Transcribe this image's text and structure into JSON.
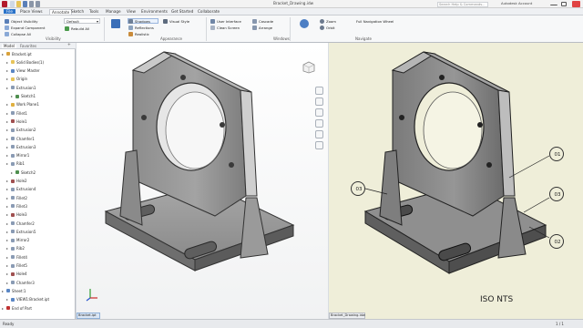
{
  "window": {
    "title": "Bracket_Drawing.idw",
    "search_placeholder": "Search Help & Commands...",
    "user": "Autodesk Account",
    "controls": [
      "minimize-icon",
      "maximize-icon",
      "close-icon"
    ]
  },
  "tabs": [
    {
      "label": "File"
    },
    {
      "label": "Place Views"
    },
    {
      "label": "Annotate",
      "active": true
    },
    {
      "label": "Sketch"
    },
    {
      "label": "Tools"
    },
    {
      "label": "Manage"
    },
    {
      "label": "View"
    },
    {
      "label": "Environments"
    },
    {
      "label": "Get Started"
    },
    {
      "label": "Collaborate"
    }
  ],
  "ribbon": {
    "groups": [
      {
        "label": "Visibility",
        "buttons": [
          "Object Visibility",
          "Expand Component",
          "Collapse All"
        ]
      },
      {
        "label": "Appearance",
        "buttons": [
          "Visual Style",
          "Shadows",
          "Reflections",
          "Realistic"
        ]
      },
      {
        "label": "Windows",
        "buttons": [
          "User Interface",
          "Clean Screen",
          "Cascade",
          "Arrange"
        ]
      },
      {
        "label": "Navigate",
        "buttons": [
          "Full Navigation Wheel",
          "Zoom",
          "Orbit"
        ]
      }
    ],
    "style_value": "Default",
    "rebuild_label": "Rebuild All"
  },
  "browser": {
    "tabs": [
      "Model",
      "Favorites"
    ],
    "tree": [
      {
        "label": "Bracket.ipt",
        "level": 0,
        "icon": "part"
      },
      {
        "label": "Solid Bodies(1)",
        "level": 1,
        "icon": "folder"
      },
      {
        "label": "View: Master",
        "level": 1,
        "icon": "view"
      },
      {
        "label": "Origin",
        "level": 1,
        "icon": "folder"
      },
      {
        "label": "Extrusion1",
        "level": 1,
        "icon": "feature"
      },
      {
        "label": "Sketch1",
        "level": 2,
        "icon": "sketch"
      },
      {
        "label": "Work Plane1",
        "level": 1,
        "icon": "plane"
      },
      {
        "label": "Fillet1",
        "level": 1,
        "icon": "feature"
      },
      {
        "label": "Hole1",
        "level": 1,
        "icon": "hole"
      },
      {
        "label": "Extrusion2",
        "level": 1,
        "icon": "feature"
      },
      {
        "label": "Chamfer1",
        "level": 1,
        "icon": "feature"
      },
      {
        "label": "Extrusion3",
        "level": 1,
        "icon": "feature"
      },
      {
        "label": "Mirror1",
        "level": 1,
        "icon": "feature"
      },
      {
        "label": "Rib1",
        "level": 1,
        "icon": "feature"
      },
      {
        "label": "Sketch2",
        "level": 2,
        "icon": "sketch"
      },
      {
        "label": "Hole2",
        "level": 1,
        "icon": "hole"
      },
      {
        "label": "Extrusion4",
        "level": 1,
        "icon": "feature"
      },
      {
        "label": "Fillet2",
        "level": 1,
        "icon": "feature"
      },
      {
        "label": "Fillet3",
        "level": 1,
        "icon": "feature"
      },
      {
        "label": "Hole3",
        "level": 1,
        "icon": "hole"
      },
      {
        "label": "Chamfer2",
        "level": 1,
        "icon": "feature"
      },
      {
        "label": "Extrusion5",
        "level": 1,
        "icon": "feature"
      },
      {
        "label": "Mirror2",
        "level": 1,
        "icon": "feature"
      },
      {
        "label": "Rib2",
        "level": 1,
        "icon": "feature"
      },
      {
        "label": "Fillet4",
        "level": 1,
        "icon": "feature"
      },
      {
        "label": "Fillet5",
        "level": 1,
        "icon": "feature"
      },
      {
        "label": "Hole4",
        "level": 1,
        "icon": "hole"
      },
      {
        "label": "Chamfer3",
        "level": 1,
        "icon": "feature"
      },
      {
        "label": "Sheet:1",
        "level": 0,
        "icon": "sheet"
      },
      {
        "label": "VIEW1:Bracket.ipt",
        "level": 1,
        "icon": "view"
      },
      {
        "label": "End of Part",
        "level": 0,
        "icon": "end"
      }
    ]
  },
  "drawing": {
    "callouts": [
      {
        "label": "01"
      },
      {
        "label": "02"
      },
      {
        "label": "03"
      },
      {
        "label": "03"
      }
    ],
    "scale_note": "ISO  NTS"
  },
  "viewport": {
    "tabs": [
      "Bracket.ipt",
      "Bracket_Drawing.idw"
    ]
  },
  "status": {
    "left": "Ready",
    "right": "1 / 1"
  },
  "colors": {
    "accent": "#2b73c9",
    "drawing_bg": "#efeed9",
    "model_bg": "#f4f5f6"
  }
}
